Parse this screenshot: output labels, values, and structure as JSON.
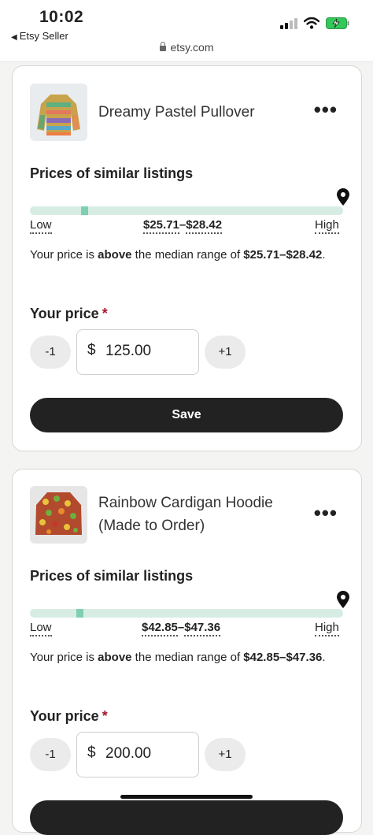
{
  "status_bar": {
    "time": "10:02",
    "back_app": "Etsy Seller",
    "url": "etsy.com"
  },
  "icons": {
    "signal": "cellular-signal-icon",
    "wifi": "wifi-icon",
    "battery": "battery-charging-icon",
    "lock": "lock-icon",
    "more": "more-horizontal-icon",
    "pin": "map-pin-icon"
  },
  "colors": {
    "bar_track": "#d7ede4",
    "median_marker": "#7fcfb2",
    "required_star": "#a61a2e",
    "save_button": "#222222",
    "battery": "#34c759"
  },
  "listings": [
    {
      "title": "Dreamy Pastel Pullover",
      "more_label": "•••",
      "similar_heading": "Prices of similar listings",
      "low_label": "Low",
      "high_label": "High",
      "range_low": "$25.71",
      "range_sep": "–",
      "range_high": "$28.42",
      "note_prefix": "Your price is ",
      "note_bold": "above",
      "note_mid": " the median range of ",
      "note_range": "$25.71–$28.42",
      "note_end": ".",
      "price_heading": "Your price",
      "required": "*",
      "minus_label": "-1",
      "plus_label": "+1",
      "currency": "$",
      "price_value": "125.00",
      "save_label": "Save"
    },
    {
      "title_line1": "Rainbow Cardigan Hoodie",
      "title_line2": "(Made to Order)",
      "more_label": "•••",
      "similar_heading": "Prices of similar listings",
      "low_label": "Low",
      "high_label": "High",
      "range_low": "$42.85",
      "range_sep": "–",
      "range_high": "$47.36",
      "note_prefix": "Your price is ",
      "note_bold": "above",
      "note_mid": " the median range of ",
      "note_range": "$42.85–$47.36",
      "note_end": ".",
      "price_heading": "Your price",
      "required": "*",
      "minus_label": "-1",
      "plus_label": "+1",
      "currency": "$",
      "price_value": "200.00"
    }
  ]
}
